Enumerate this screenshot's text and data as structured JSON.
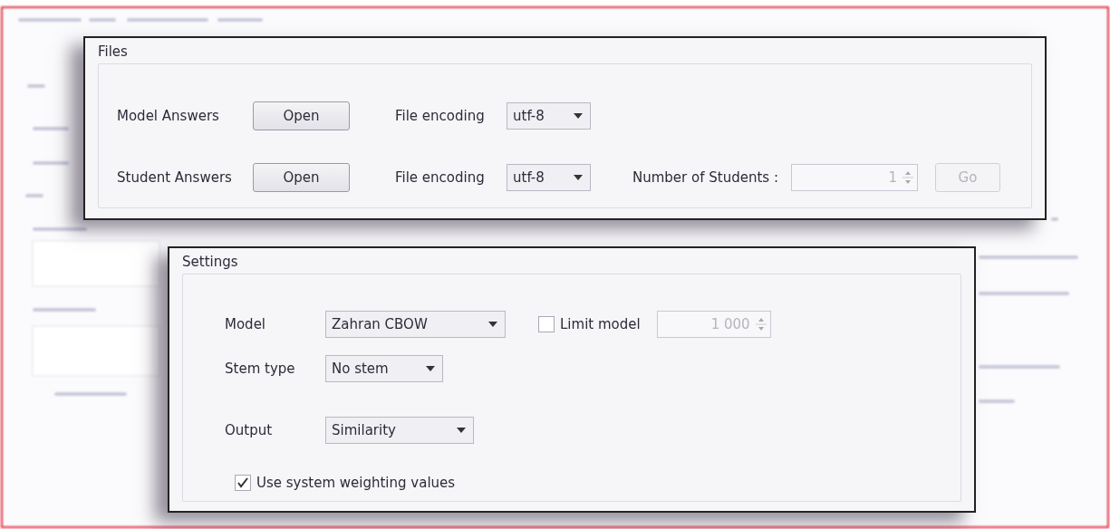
{
  "files": {
    "title": "Files",
    "rows": [
      {
        "label": "Model Answers",
        "button": "Open",
        "encoding_label": "File encoding",
        "encoding": "utf-8"
      },
      {
        "label": "Student Answers",
        "button": "Open",
        "encoding_label": "File encoding",
        "encoding": "utf-8",
        "students_label": "Number of Students :",
        "students": "1",
        "go": {
          "label": "Go",
          "disabled": true
        }
      }
    ]
  },
  "settings": {
    "title": "Settings",
    "model": {
      "label": "Model",
      "value": "Zahran CBOW"
    },
    "limit": {
      "label": "Limit model",
      "checked": false,
      "value": "1 000",
      "disabled": true
    },
    "stem": {
      "label": "Stem type",
      "value": "No stem"
    },
    "output": {
      "label": "Output",
      "value": "Similarity"
    },
    "weighting": {
      "label": "Use system weighting values",
      "checked": true
    }
  }
}
